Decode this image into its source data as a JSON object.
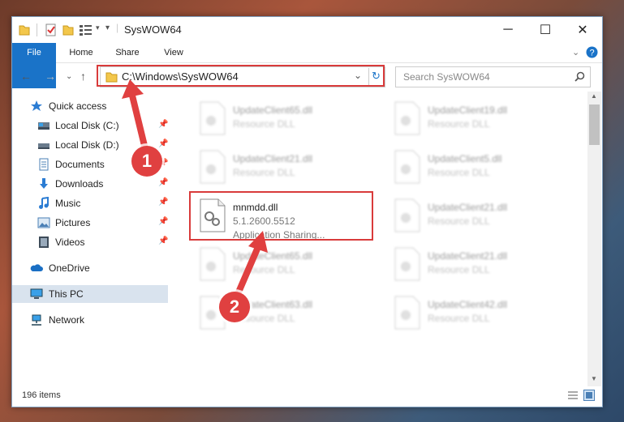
{
  "window": {
    "title": "SysWOW64"
  },
  "ribbon": {
    "tabs": [
      {
        "label": "File"
      },
      {
        "label": "Home"
      },
      {
        "label": "Share"
      },
      {
        "label": "View"
      }
    ]
  },
  "address": {
    "path": "C:\\Windows\\SysWOW64"
  },
  "search": {
    "placeholder": "Search SysWOW64"
  },
  "sidebar": {
    "items": [
      {
        "label": "Quick access",
        "icon": "star-icon"
      },
      {
        "label": "Local Disk (C:)",
        "icon": "drive-icon"
      },
      {
        "label": "Local Disk (D:)",
        "icon": "drive-icon"
      },
      {
        "label": "Documents",
        "icon": "documents-icon"
      },
      {
        "label": "Downloads",
        "icon": "downloads-icon"
      },
      {
        "label": "Music",
        "icon": "music-icon"
      },
      {
        "label": "Pictures",
        "icon": "pictures-icon"
      },
      {
        "label": "Videos",
        "icon": "videos-icon"
      },
      {
        "label": "OneDrive",
        "icon": "onedrive-icon"
      },
      {
        "label": "This PC",
        "icon": "pc-icon"
      },
      {
        "label": "Network",
        "icon": "network-icon"
      }
    ]
  },
  "files": [
    {
      "name": "UpdateClient65.dll",
      "sub": "Resource DLL"
    },
    {
      "name": "UpdateClient19.dll",
      "sub": "Resource DLL"
    },
    {
      "name": "UpdateClient21.dll",
      "sub": "Resource DLL"
    },
    {
      "name": "UpdateClient5.dll",
      "sub": "Resource DLL"
    },
    {
      "name": "mnmdd.dll",
      "sub": "5.1.2600.5512",
      "sub2": "Application Sharing..."
    },
    {
      "name": "UpdateClient21.dll",
      "sub": "Resource DLL"
    },
    {
      "name": "UpdateClient65.dll",
      "sub": "Resource DLL"
    },
    {
      "name": "UpdateClient21.dll",
      "sub": "Resource DLL"
    },
    {
      "name": "UpdateClient63.dll",
      "sub": "Resource DLL"
    },
    {
      "name": "UpdateClient42.dll",
      "sub": "Resource DLL"
    }
  ],
  "status": {
    "count": "196 items"
  },
  "annotations": {
    "badge1": "1",
    "badge2": "2"
  },
  "colors": {
    "accent": "#1a73c8",
    "highlight": "#d93b3b"
  }
}
